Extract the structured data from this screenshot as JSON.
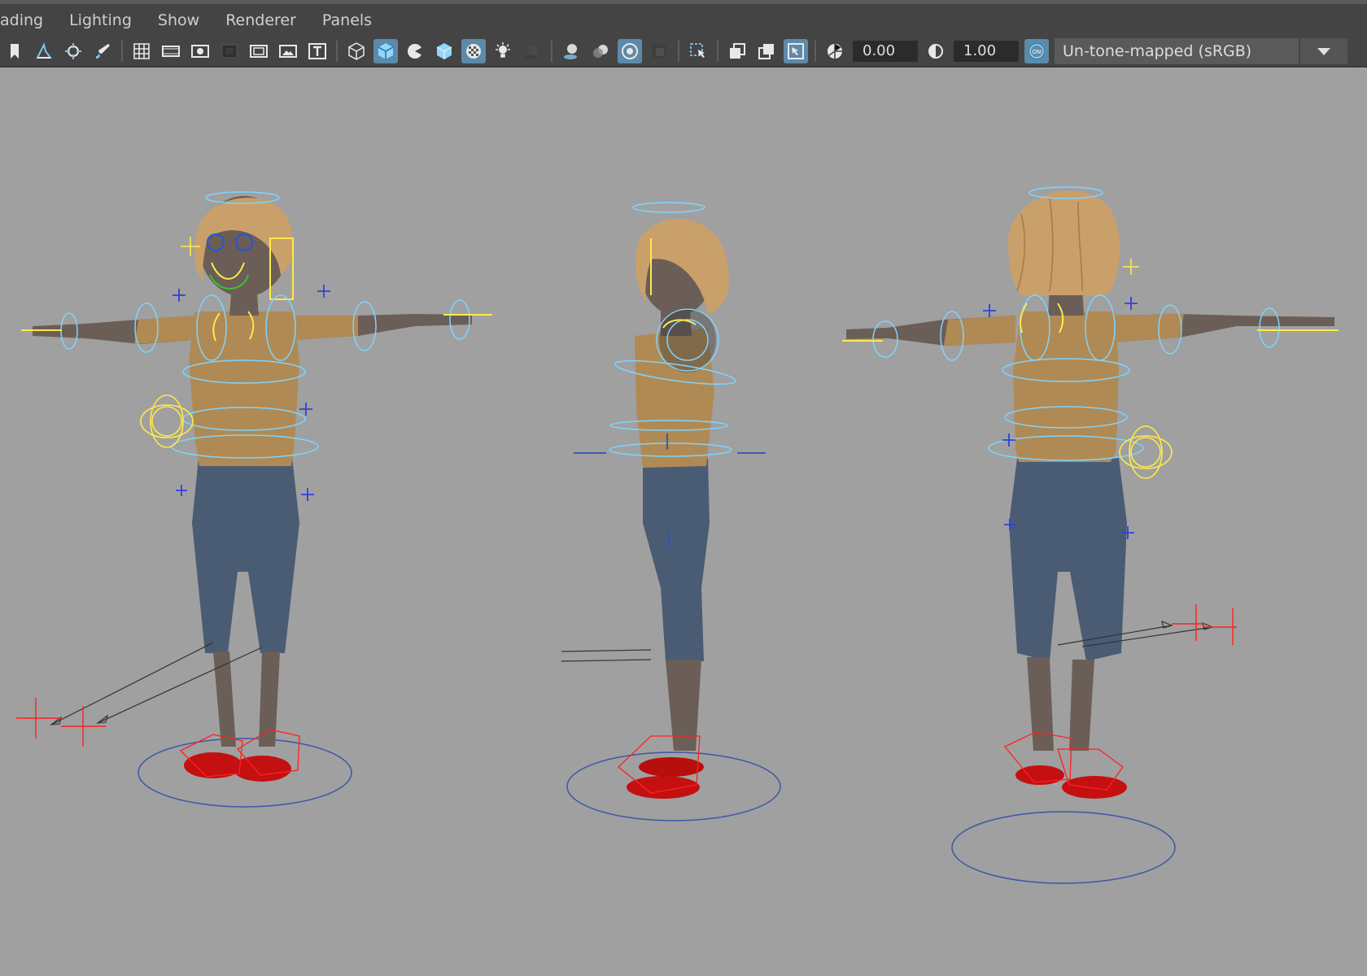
{
  "menubar": {
    "items": [
      "ading",
      "Lighting",
      "Show",
      "Renderer",
      "Panels"
    ]
  },
  "toolbar": {
    "icons": [
      "bookmark-icon",
      "select-camera-icon",
      "camera-tumble-icon",
      "paint-brush-icon",
      "grid-icon",
      "film-gate-icon",
      "resolution-gate-icon",
      "gate-mask-icon",
      "field-chart-icon",
      "safe-action-icon",
      "safe-title-icon",
      "wireframe-icon",
      "smooth-shade-icon",
      "use-default-material-icon",
      "wireframe-on-shaded-icon",
      "xray-icon",
      "use-all-lights-icon",
      "shadows-icon",
      "screen-space-ao-icon",
      "motion-blur-icon",
      "anti-aliasing-icon",
      "depth-of-field-icon",
      "select-tool-icon",
      "isolate-select-icon",
      "xray-joints-icon",
      "xray-active-icon",
      "exposure-icon",
      "gamma-icon",
      "color-management-on-icon"
    ],
    "exposure_value": "0.00",
    "gamma_value": "1.00",
    "color_mgmt_badge": "ON",
    "view_transform": "Un-tone-mapped (sRGB)"
  },
  "colors": {
    "ui_bg": "#444444",
    "viewport_bg": "#a0a0a0",
    "active_button": "#5c8aa9",
    "control_cyan": "#7fd4ff",
    "control_yellow": "#ffe94a",
    "control_red": "#ff2020",
    "sweater": "#b08a54",
    "pants": "#4a5c74",
    "skin": "#6b5e56",
    "hair": "#caa06a",
    "shoes": "#c41010"
  },
  "viewport": {
    "views": [
      "front-view-character",
      "side-view-character",
      "back-view-character"
    ]
  }
}
